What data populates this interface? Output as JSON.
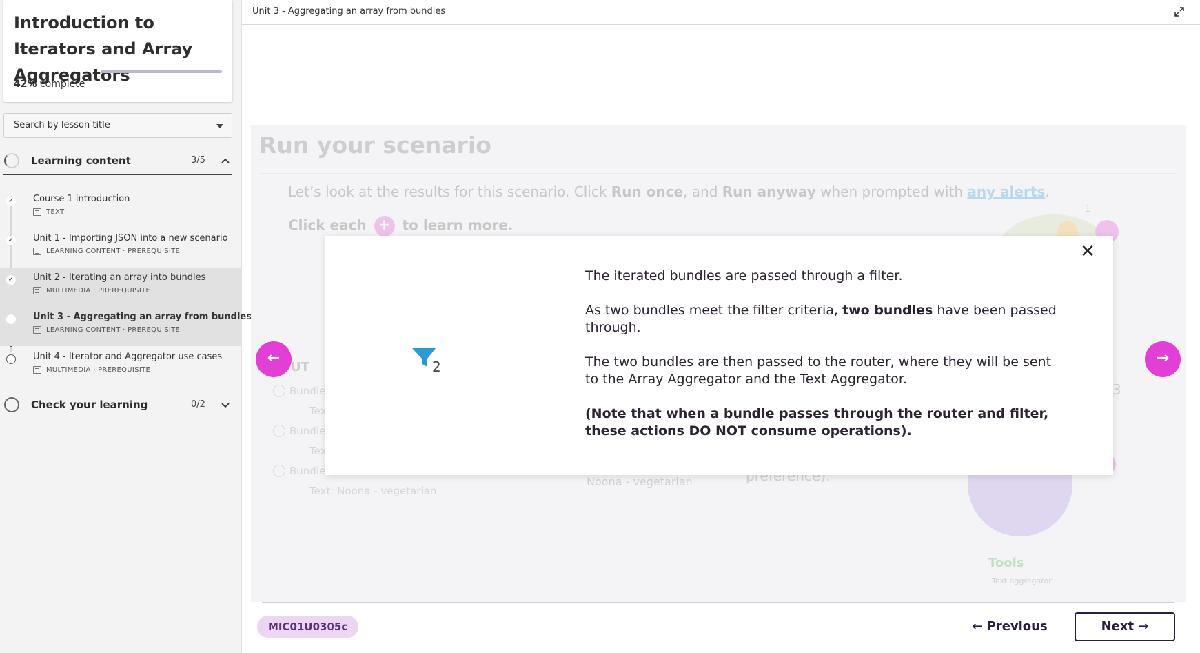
{
  "sidebar": {
    "course_title": "Introduction to Iterators and Array Aggregators",
    "progress": {
      "percent_label": "42%",
      "suffix": "complete",
      "value": 0.42
    },
    "search": {
      "placeholder": "Search by lesson title"
    },
    "sections": [
      {
        "label": "Learning content",
        "count": "3/5",
        "expanded": true
      },
      {
        "label": "Check your learning",
        "count": "0/2",
        "expanded": false
      }
    ],
    "lessons": [
      {
        "title": "Course 1 introduction",
        "meta": "TEXT",
        "status": "done"
      },
      {
        "title": "Unit 1 - Importing JSON into a new scenario",
        "meta": "LEARNING CONTENT · PREREQUISITE",
        "status": "done"
      },
      {
        "title": "Unit 2 - Iterating an array into bundles",
        "meta": "MULTIMEDIA · PREREQUISITE",
        "status": "done"
      },
      {
        "title": "Unit 3 - Aggregating an array from bundles",
        "meta": "LEARNING CONTENT · PREREQUISITE",
        "status": "current"
      },
      {
        "title": "Unit 4 - Iterator and Aggregator use cases",
        "meta": "MULTIMEDIA · PREREQUISITE",
        "status": "todo"
      }
    ]
  },
  "topbar": {
    "breadcrumb": "Unit 3 - Aggregating an array from bundles"
  },
  "stage": {
    "title": "Run your scenario",
    "p1_a": "Let’s look at the results for this scenario. Click ",
    "p1_b": "Run once",
    "p1_c": ", and ",
    "p1_d": "Run anyway",
    "p1_e": " when prompted with ",
    "p1_link": "any alerts",
    "p1_f": ".",
    "p2_a": "Click each",
    "p2_b": "to learn more.",
    "bg_out": "UT",
    "bg_bundle": "Bundle",
    "bg_tex": "Tex",
    "bg_text_noona": "Text: Noona - vegetarian",
    "bg_noona": "Noona - vegetarian",
    "bg_pref": "preference).",
    "bg_tools": "Tools",
    "bg_tools_sub": "Text aggregator",
    "bg_one": "1",
    "bg_three": "3"
  },
  "modal": {
    "badge_number": "2",
    "line1": "The iterated bundles are passed through a filter.",
    "line2_a": "As two bundles meet the filter criteria, ",
    "line2_b": "two bundles",
    "line2_c": " have been passed through.",
    "line3": "The two bundles are then passed to the router, where they will be sent to the Array Aggregator and the Text Aggregator.",
    "note": "(Note that when a bundle passes through the router and filter, these actions DO NOT consume operations)."
  },
  "footer": {
    "code": "MIC01U0305c",
    "previous": "← Previous",
    "next": "Next →"
  },
  "colors": {
    "accent_pink": "#e23fd6",
    "badge_bg": "#ecd6f4",
    "filter_blue": "#2b9ad3",
    "dark_navy": "#2a1f3d"
  }
}
